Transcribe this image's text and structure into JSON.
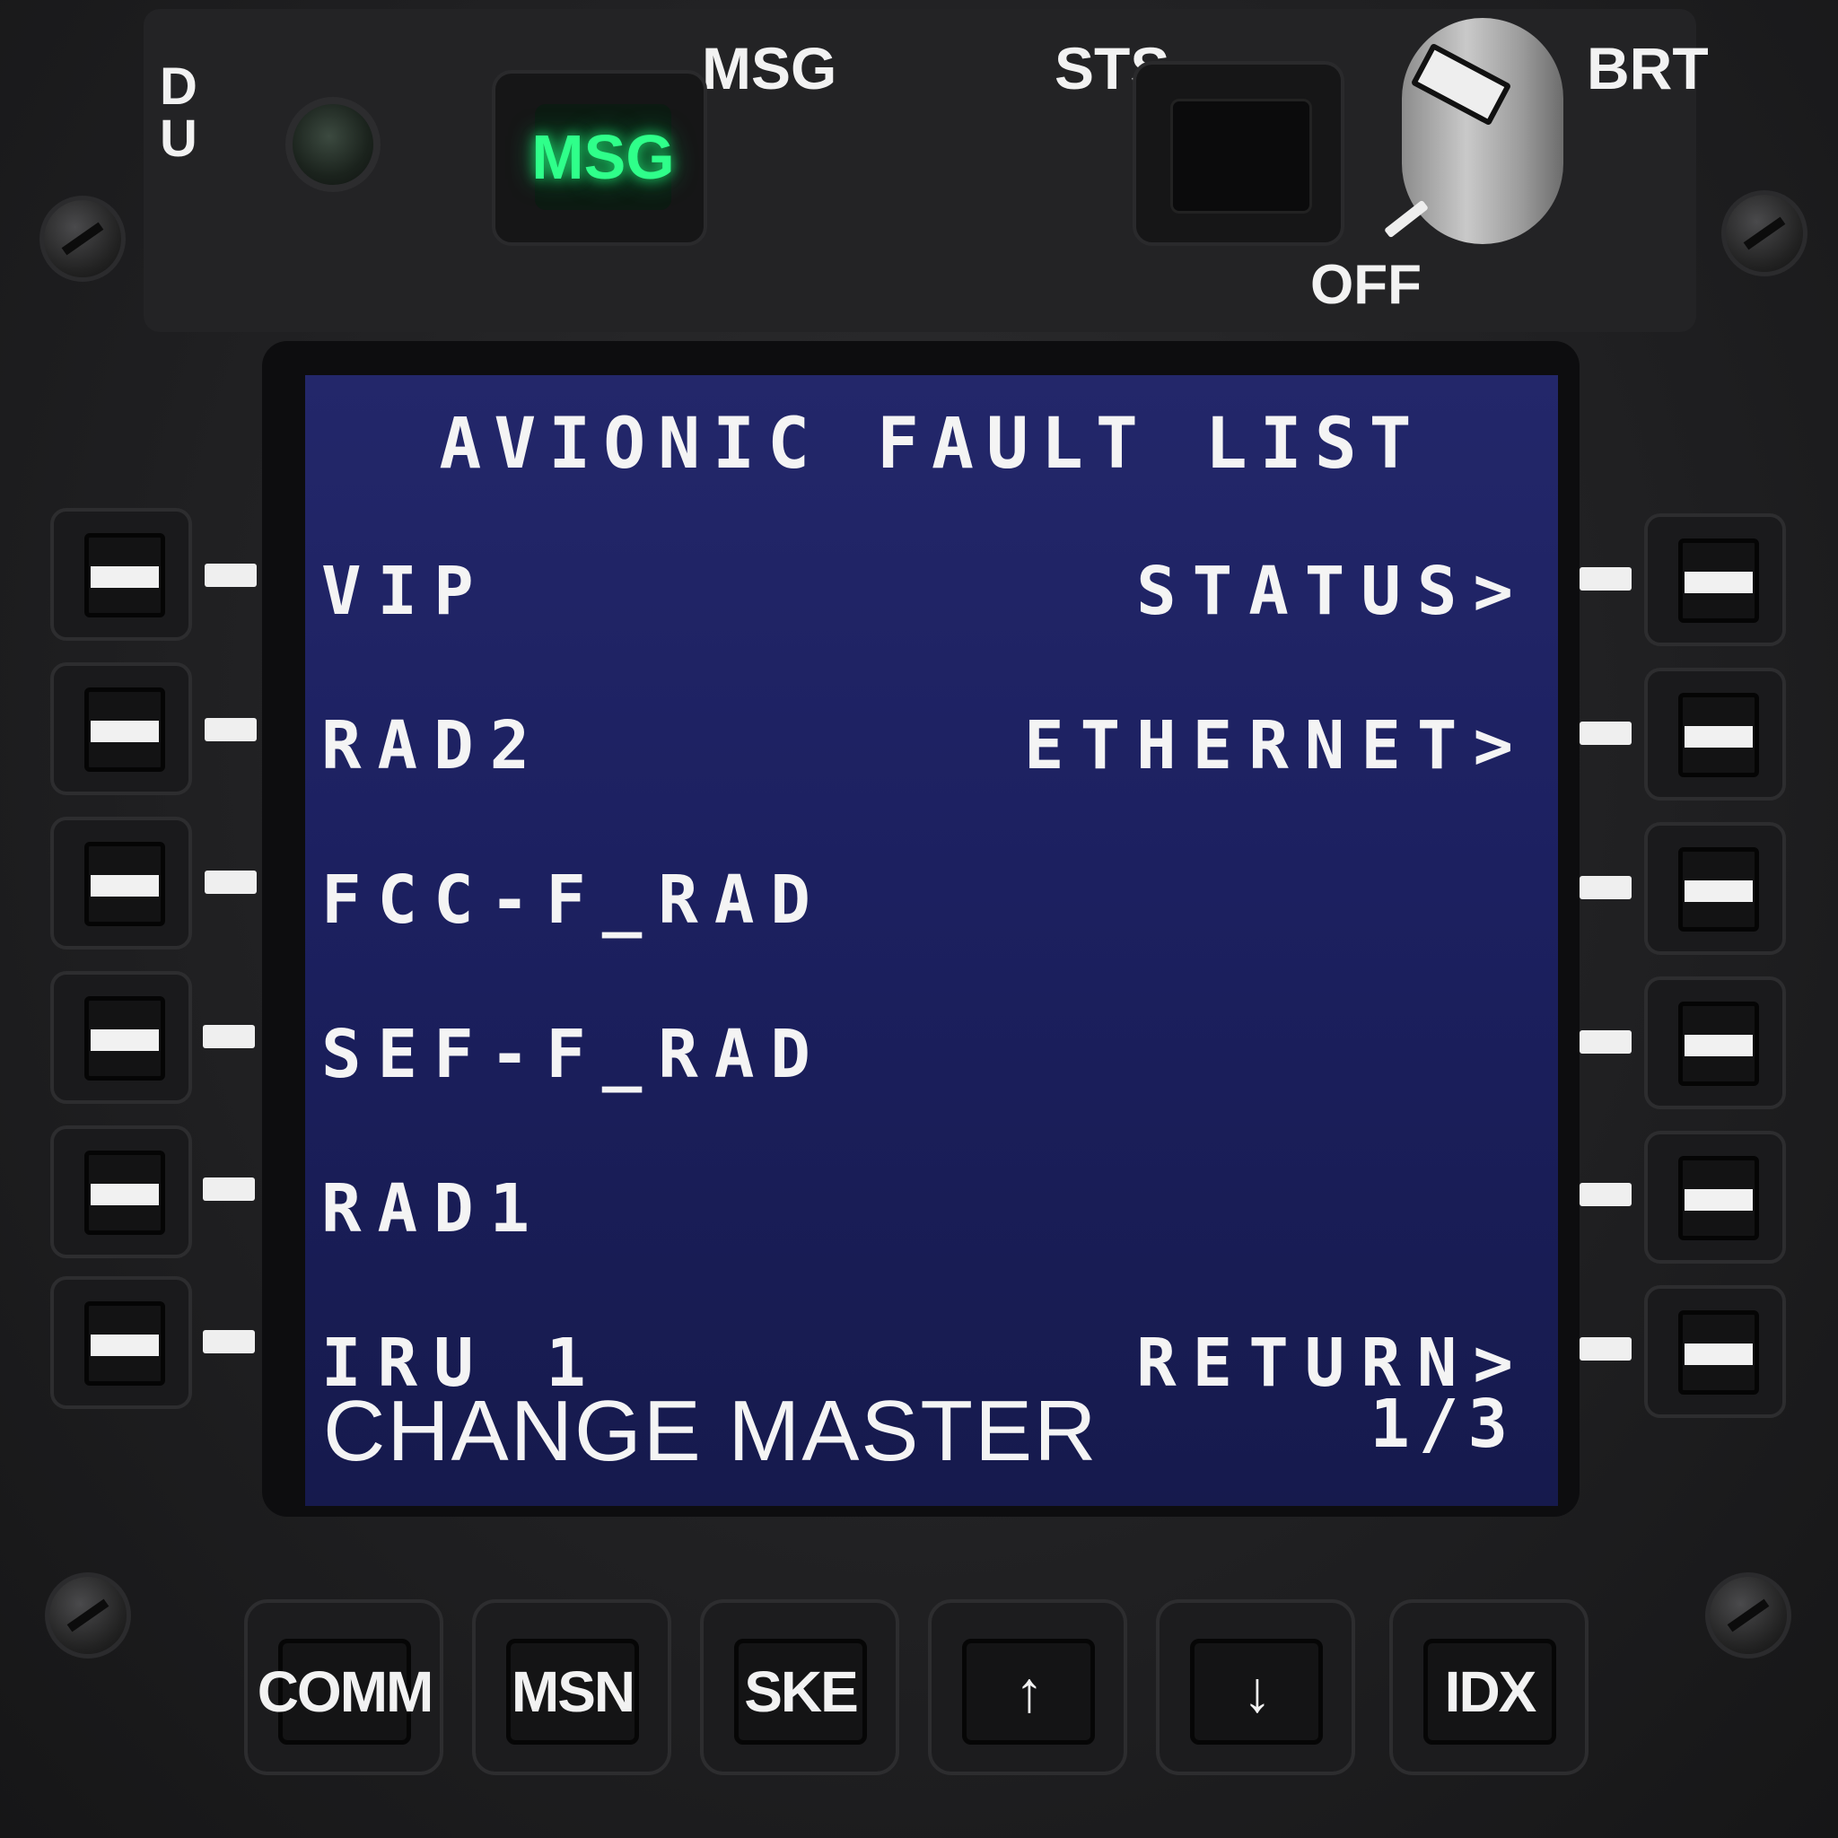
{
  "panel": {
    "du_label": "D\nU",
    "msg_label": "MSG",
    "sts_label": "STS",
    "brt_label": "BRT",
    "off_label": "OFF",
    "msg_lamp_text": "MSG",
    "msg_lamp_color": "#2fff8a"
  },
  "screen": {
    "title": "AVIONIC FAULT LIST",
    "left_items": [
      "VIP",
      "RAD2",
      "FCC-F_RAD",
      "SEF-F_RAD",
      "RAD1",
      "IRU 1"
    ],
    "right_items": [
      "STATUS>",
      "ETHERNET>",
      "",
      "",
      "",
      "RETURN>"
    ],
    "footer_left": "CHANGE MASTER",
    "footer_right": "1/3",
    "background_color": "#1c2060"
  },
  "keys": [
    "COMM",
    "MSN",
    "SKE",
    "↑",
    "↓",
    "IDX"
  ]
}
